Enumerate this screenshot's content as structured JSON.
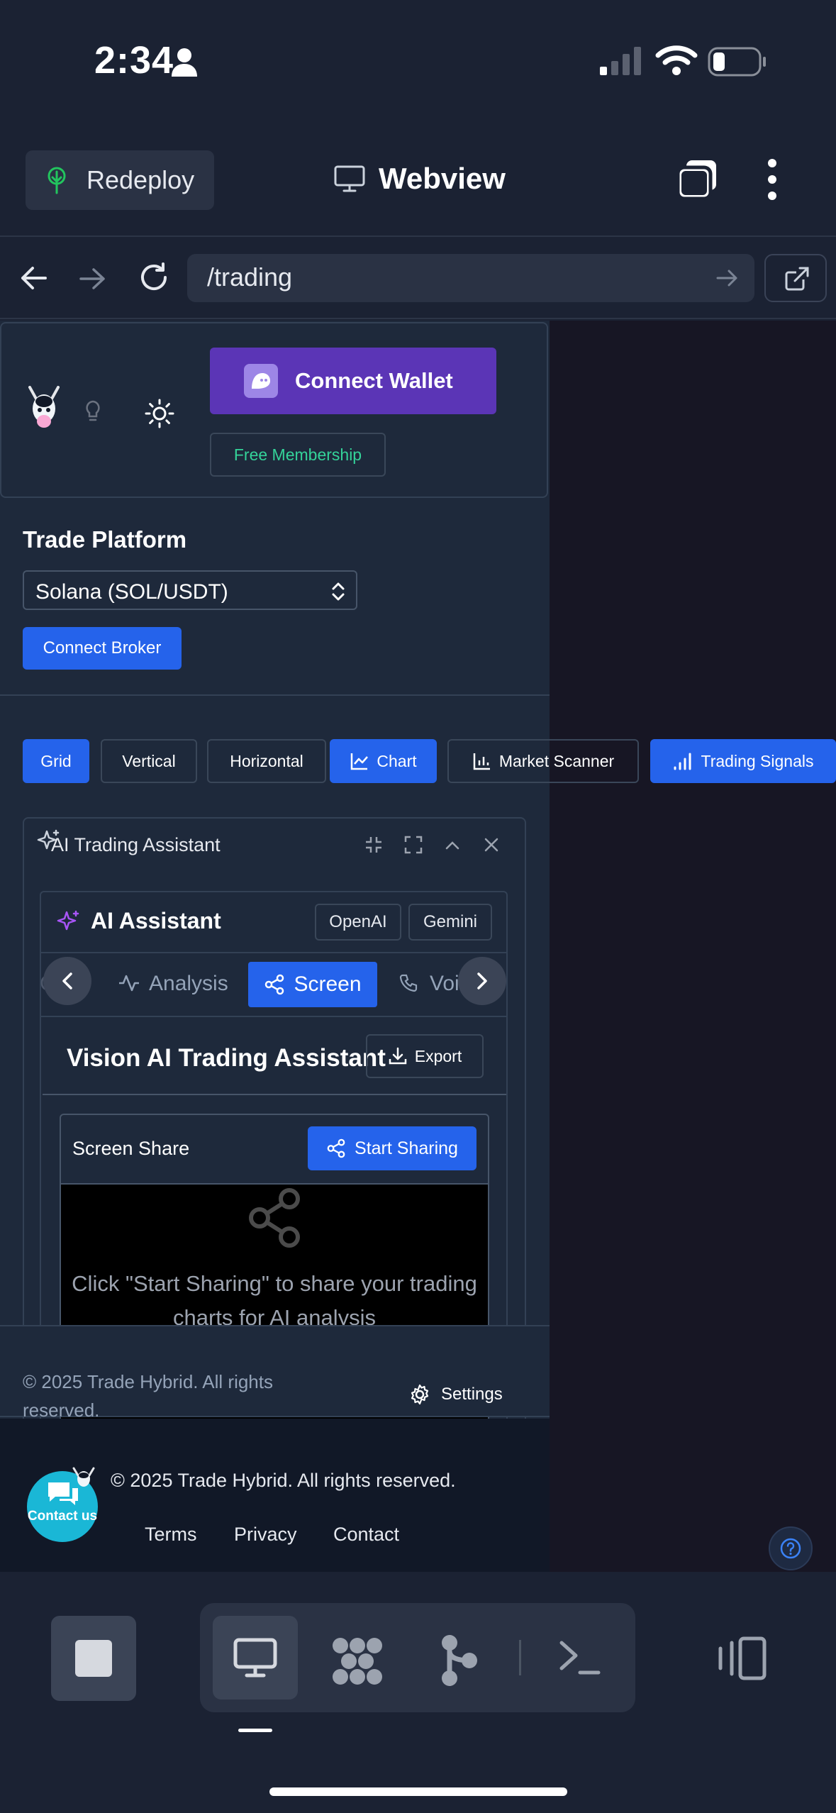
{
  "status_bar": {
    "time": "2:34"
  },
  "top_bar": {
    "redeploy_label": "Redeploy",
    "webview_label": "Webview"
  },
  "nav": {
    "url": "/trading"
  },
  "header": {
    "connect_wallet_label": "Connect Wallet",
    "free_membership_label": "Free Membership"
  },
  "trade_platform": {
    "title": "Trade Platform",
    "pair_selected": "Solana (SOL/USDT)",
    "connect_broker_label": "Connect Broker"
  },
  "view_buttons": {
    "grid": "Grid",
    "vertical": "Vertical",
    "horizontal": "Horizontal",
    "chart": "Chart",
    "market_scanner": "Market Scanner",
    "trading_signals": "Trading Signals"
  },
  "ai_panel": {
    "title": "AI Trading Assistant",
    "assistant_title": "AI Assistant",
    "providers": [
      "OpenAI",
      "Gemini"
    ],
    "tabs": {
      "partial_left": "Ch",
      "analysis": "Analysis",
      "screen": "Screen",
      "partial_right": "Voi"
    },
    "vision_title": "Vision AI Trading Assistant",
    "export_label": "Export",
    "screen_share_label": "Screen Share",
    "start_sharing_label": "Start Sharing",
    "share_message": "Click \"Start Sharing\" to share your trading charts for AI analysis"
  },
  "footer": {
    "copyright_short": "© 2025 Trade Hybrid. All rights reserved.",
    "settings_label": "Settings",
    "copyright_full": "© 2025 Trade Hybrid. All rights reserved.",
    "links": [
      "Terms",
      "Privacy",
      "Contact"
    ],
    "contact_us_label": "Contact us"
  },
  "icons": {
    "redeploy": "tree-icon",
    "webview": "monitor-icon",
    "tabs": "tabs-icon",
    "menu": "more-vertical-icon",
    "back": "arrow-left-icon",
    "forward": "arrow-right-icon",
    "reload": "refresh-icon",
    "open_external": "external-link-icon"
  },
  "colors": {
    "accent_blue": "#2563eb",
    "wallet_purple": "#5b35b6",
    "membership_green": "#34d399",
    "contact_cyan": "#1ab7d6"
  }
}
